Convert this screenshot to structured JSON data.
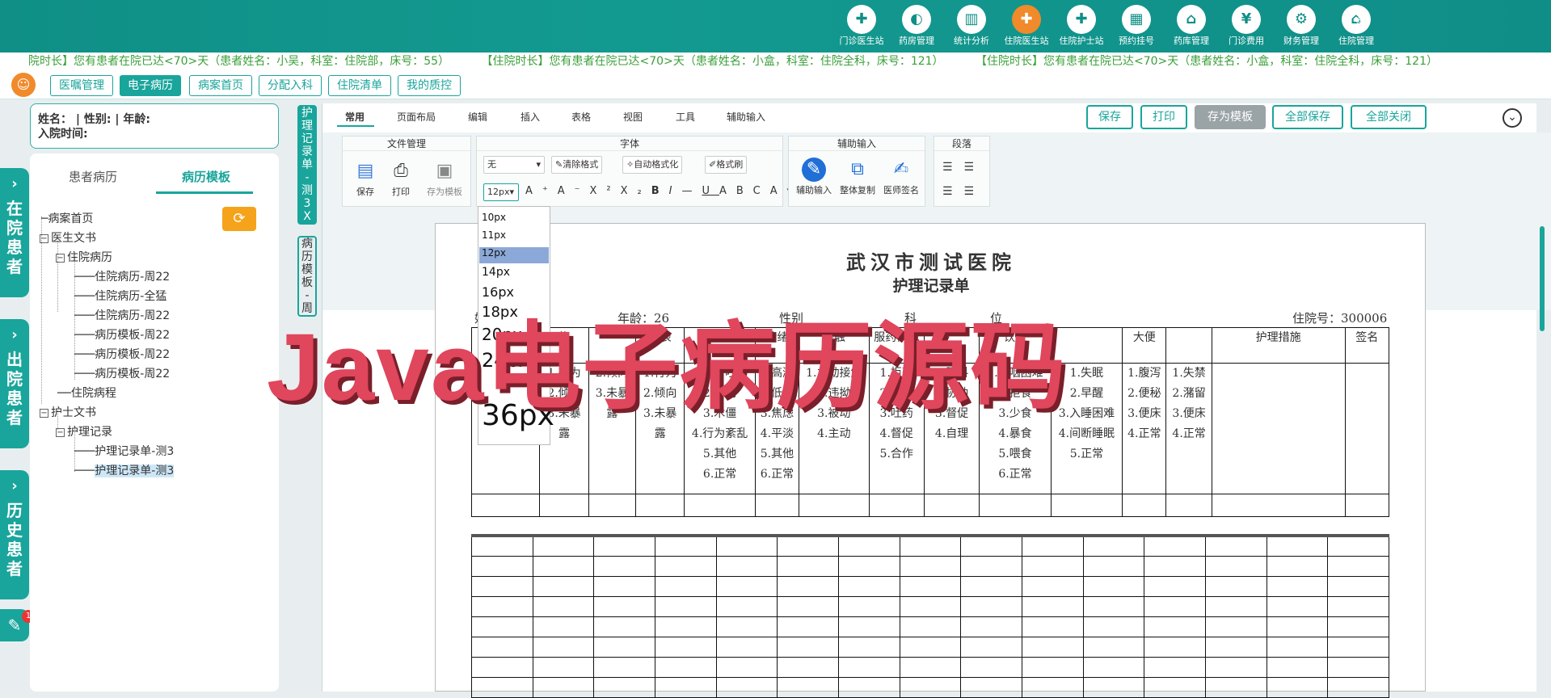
{
  "nav": {
    "items": [
      {
        "label": "门诊医生站",
        "icon": "doctor-icon",
        "glyph": "✚"
      },
      {
        "label": "药房管理",
        "icon": "pill-icon",
        "glyph": "◐"
      },
      {
        "label": "统计分析",
        "icon": "chart-icon",
        "glyph": "▥"
      },
      {
        "label": "住院医生站",
        "icon": "inpatient-doctor-icon",
        "glyph": "✚"
      },
      {
        "label": "住院护士站",
        "icon": "nurse-icon",
        "glyph": "✚"
      },
      {
        "label": "预约挂号",
        "icon": "calendar-icon",
        "glyph": "▦"
      },
      {
        "label": "药库管理",
        "icon": "warehouse-icon",
        "glyph": "⌂"
      },
      {
        "label": "门诊费用",
        "icon": "yen-icon",
        "glyph": "¥"
      },
      {
        "label": "财务管理",
        "icon": "gear-icon",
        "glyph": "⚙"
      },
      {
        "label": "住院管理",
        "icon": "bed-icon",
        "glyph": "⌂"
      }
    ]
  },
  "ticker": [
    "院时长】您有患者在院已达<70>天（患者姓名：小吴，科室：住院部，床号：55）",
    "【住院时长】您有患者在院已达<70>天（患者姓名：小盒，科室：住院全科，床号：121）",
    "【住院时长】您有患者在院已达<70>天（患者姓名：小盒，科室：住院全科，床号：121）"
  ],
  "tabs": [
    "医嘱管理",
    "电子病历",
    "病案首页",
    "分配入科",
    "住院清单",
    "我的质控"
  ],
  "side_tabs": [
    "在院患者",
    "出院患者",
    "历史患者"
  ],
  "notification_count": "1",
  "patient": {
    "line1": "姓名：   | 性别:    | 年龄:",
    "line2": "入院时间:"
  },
  "left_panel": {
    "tab1": "患者病历",
    "tab2": "病历模板"
  },
  "tree": {
    "n0": "病案首页",
    "n1": "医生文书",
    "n2": "住院病历",
    "n3": "住院病历-周22",
    "n4": "住院病历-全猛",
    "n5": "住院病历-周22",
    "n6": "病历模板-周22",
    "n7": "病历模板-周22",
    "n8": "病历模板-周22",
    "n9": "住院病程",
    "n10": "护士文书",
    "n11": "护理记录",
    "n12": "护理记录单-测3",
    "n13": "护理记录单-测3"
  },
  "vtabs": {
    "active": "护理记录单-测3X",
    "other": "病历模板-周"
  },
  "menu": [
    "常用",
    "页面布局",
    "编辑",
    "插入",
    "表格",
    "视图",
    "工具",
    "辅助输入"
  ],
  "toolbar": {
    "save": "保存",
    "print": "打印",
    "save_template": "存为模板",
    "save_all": "全部保存",
    "close_all": "全部关闭"
  },
  "ribbon": {
    "file_group": "文件管理",
    "font_group": "字体",
    "assist_group": "辅助输入",
    "para_group": "段落",
    "save": "保存",
    "print": "打印",
    "save_tpl": "存为模板",
    "font_name": "无",
    "font_size": "12px",
    "clear_format": "清除格式",
    "auto_format": "自动格式化",
    "format_brush": "格式刷",
    "assist_input": "辅助输入",
    "copy_all": "整体复制",
    "doctor_sign": "医师签名"
  },
  "font_sizes": [
    "10px",
    "11px",
    "12px",
    "14px",
    "16px",
    "18px",
    "20px",
    "24px",
    "36px"
  ],
  "document": {
    "hospital": "武汉市测试医院",
    "title": "护理记录单",
    "name_label": "姓",
    "age": "年龄：26",
    "sex_label": "性别",
    "dept_label": "科",
    "bed_label": "位",
    "admission_no": "住院号：300006",
    "headers": [
      "",
      "物",
      "外表",
      "",
      "情绪",
      "接触",
      "服药情况",
      "",
      "饮食",
      "",
      "大便",
      "",
      "护理措施",
      "签名"
    ],
    "col2": [
      "1.行为",
      "2.倾向",
      "3.未暴",
      "露"
    ],
    "col3": [
      "2.倾向",
      "3.未暴",
      "露"
    ],
    "col4": [
      "1.行为",
      "2.倾向",
      "3.未暴",
      "露"
    ],
    "col5": [
      "1.兴奋吵闹",
      "2.少动",
      "3.木僵",
      "4.行为紊乱",
      "5.其他",
      "6.正常"
    ],
    "col6": [
      "1.高涨",
      "2.低落",
      "3.焦虑",
      "4.平淡",
      "5.其他",
      "6.正常"
    ],
    "col7": [
      "1.主动接触",
      "2.违拗",
      "3.被动",
      "4.主动"
    ],
    "col8": [
      "1.拒药",
      "2.藏药",
      "3.吐药",
      "4.督促",
      "5.合作"
    ],
    "col9": [
      "1.照料",
      "2.协助",
      "3.督促",
      "4.自理"
    ],
    "col10": [
      "1.吞咽困难",
      "2.拒食",
      "3.少食",
      "4.暴食",
      "5.喂食",
      "6.正常"
    ],
    "col11": [
      "1.失眠",
      "2.早醒",
      "3.入睡困难",
      "4.间断睡眠",
      "5.正常"
    ],
    "col12": [
      "1.腹泻",
      "2.便秘",
      "3.便床",
      "4.正常"
    ],
    "col13": [
      "1.失禁",
      "2.潴留",
      "3.便床",
      "4.正常"
    ]
  },
  "watermark": "Java电子病历源码"
}
